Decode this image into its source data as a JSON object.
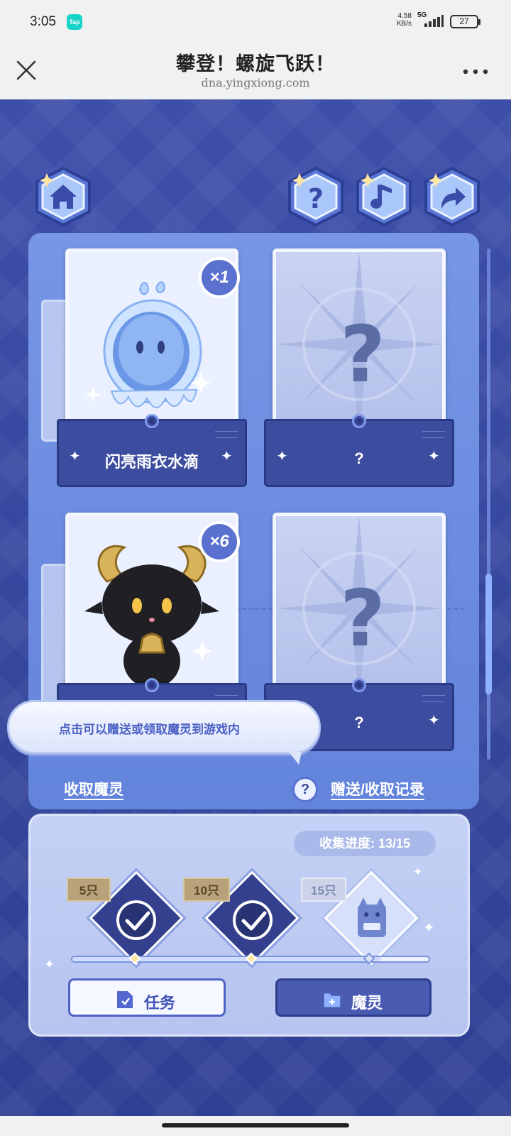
{
  "status_bar": {
    "time": "3:05",
    "app_badge": "Tap",
    "net_speed": "4.58",
    "net_unit": "KB/s",
    "network": "5G",
    "battery": "27"
  },
  "header": {
    "title": "攀登！螺旋飞跃！",
    "url": "dna.yingxiong.com"
  },
  "cards": [
    {
      "name": "闪亮雨衣水滴",
      "count": "×1",
      "revealed": true
    },
    {
      "name": "?",
      "count": "",
      "revealed": false
    },
    {
      "name": "",
      "count": "×6",
      "revealed": true
    },
    {
      "name": "?",
      "count": "",
      "revealed": false
    }
  ],
  "unknown_mark": "?",
  "tooltip": "点击可以赠送或领取魔灵到游戏内",
  "links": {
    "receive": "收取魔灵",
    "record": "赠送/收取记录",
    "help": "?"
  },
  "progress": {
    "label": "收集进度: 13/15",
    "collected": 13,
    "total": 15,
    "milestones": [
      {
        "label": "5只",
        "claimed": true
      },
      {
        "label": "10只",
        "claimed": true
      },
      {
        "label": "15只",
        "claimed": false
      }
    ]
  },
  "buttons": {
    "tasks": "任务",
    "spirits": "魔灵"
  },
  "icons": {
    "home": "home-icon",
    "help": "help-icon",
    "music": "music-icon",
    "share": "share-icon",
    "close": "close-icon",
    "more": "more-icon"
  }
}
